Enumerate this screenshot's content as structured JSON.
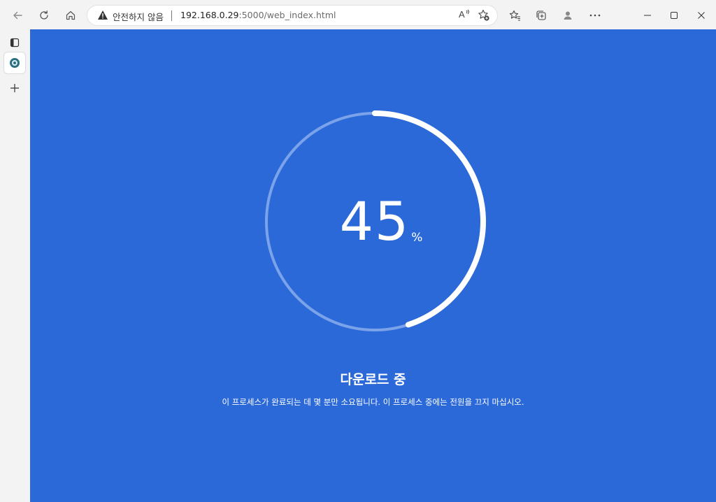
{
  "browser": {
    "security_label": "안전하지 않음",
    "url_host": "192.168.0.29",
    "url_rest": ":5000/web_index.html",
    "read_aloud_label": "A’’"
  },
  "page": {
    "progress_value": "45",
    "progress_unit": "%",
    "progress_fraction": 0.45,
    "title": "다운로드 중",
    "description": "이 프로세스가 완료되는 데 몇 분만 소요됩니다. 이 프로세스 중에는 전원을 끄지 마십시오."
  },
  "colors": {
    "background": "#2b69d9",
    "ring_track": "#7ba3ea",
    "ring_progress": "#ffffff"
  }
}
